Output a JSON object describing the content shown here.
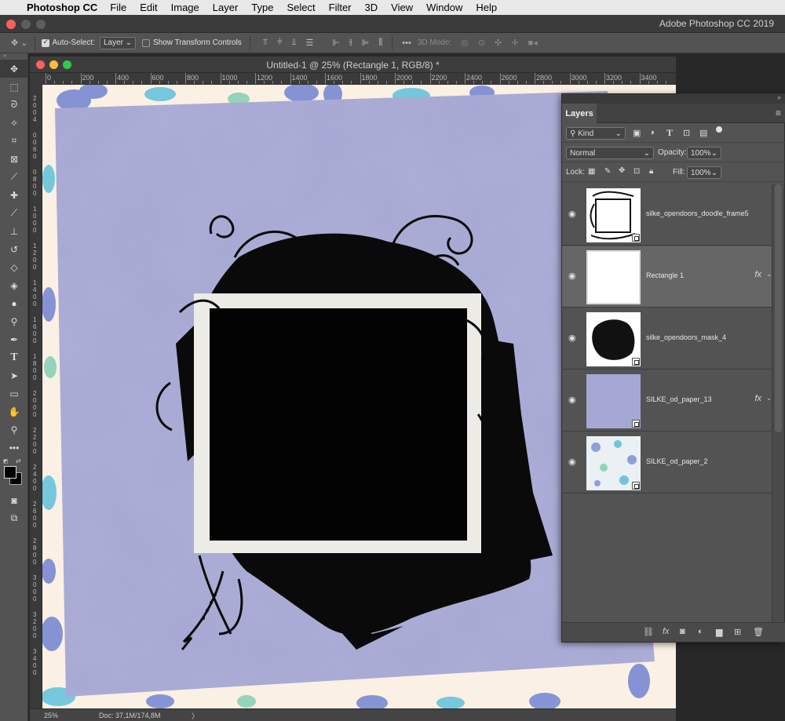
{
  "menubar": {
    "app_name": "Photoshop CC",
    "items": [
      "File",
      "Edit",
      "Image",
      "Layer",
      "Type",
      "Select",
      "Filter",
      "3D",
      "View",
      "Window",
      "Help"
    ]
  },
  "titlebar": {
    "app_title": "Adobe Photoshop CC 2019"
  },
  "options": {
    "auto_select_label": "Auto-Select:",
    "auto_select_checked": true,
    "auto_select_target": "Layer",
    "show_transform_label": "Show Transform Controls",
    "show_transform_checked": false,
    "mode_3d_label": "3D Mode:"
  },
  "document": {
    "title": "Untitled-1 @ 25% (Rectangle 1, RGB/8) *",
    "ruler_h": [
      "0",
      "200",
      "400",
      "600",
      "800",
      "1000",
      "1200",
      "1400",
      "1600",
      "1800",
      "2000",
      "2200",
      "2400",
      "2600",
      "2800",
      "3000",
      "3200",
      "3400"
    ],
    "ruler_v": [
      "2",
      "0",
      "0",
      "4",
      "0",
      "0",
      "6",
      "0",
      "0",
      "8",
      "0",
      "0",
      "1",
      "0",
      "0",
      "0",
      "1",
      "2",
      "0",
      "0",
      "1",
      "4",
      "0",
      "0",
      "1",
      "6",
      "0",
      "0",
      "1",
      "8",
      "0",
      "0",
      "2",
      "0",
      "0",
      "0",
      "2",
      "2",
      "0",
      "0",
      "2",
      "4",
      "0",
      "0",
      "2",
      "6",
      "0",
      "0",
      "2",
      "8",
      "0",
      "0",
      "3",
      "0",
      "0",
      "0",
      "3",
      "2",
      "0",
      "0",
      "3",
      "4",
      "0",
      "0"
    ],
    "zoom": "25%",
    "doc_info": "Doc: 37,1M/174,8M"
  },
  "layers_panel": {
    "tab_label": "Layers",
    "filter_kind": "Kind",
    "blend_mode": "Normal",
    "opacity_label": "Opacity:",
    "opacity_value": "100%",
    "lock_label": "Lock:",
    "fill_label": "Fill:",
    "fill_value": "100%",
    "layers": [
      {
        "name": "silke_opendoors_doodle_frame5",
        "fx": "",
        "selected": false
      },
      {
        "name": "Rectangle 1",
        "fx": "fx",
        "selected": true
      },
      {
        "name": "silke_opendoors_mask_4",
        "fx": "",
        "selected": false
      },
      {
        "name": "SILKE_od_paper_13",
        "fx": "fx",
        "selected": false
      },
      {
        "name": "SILKE_od_paper_2",
        "fx": "",
        "selected": false
      }
    ]
  },
  "colors": {
    "panel": "#535353",
    "paper_purple": "#a6a8d3",
    "floral_blue": "#7f8fd4",
    "floral_cyan": "#6ec5dc",
    "cream": "#faf0e4"
  }
}
